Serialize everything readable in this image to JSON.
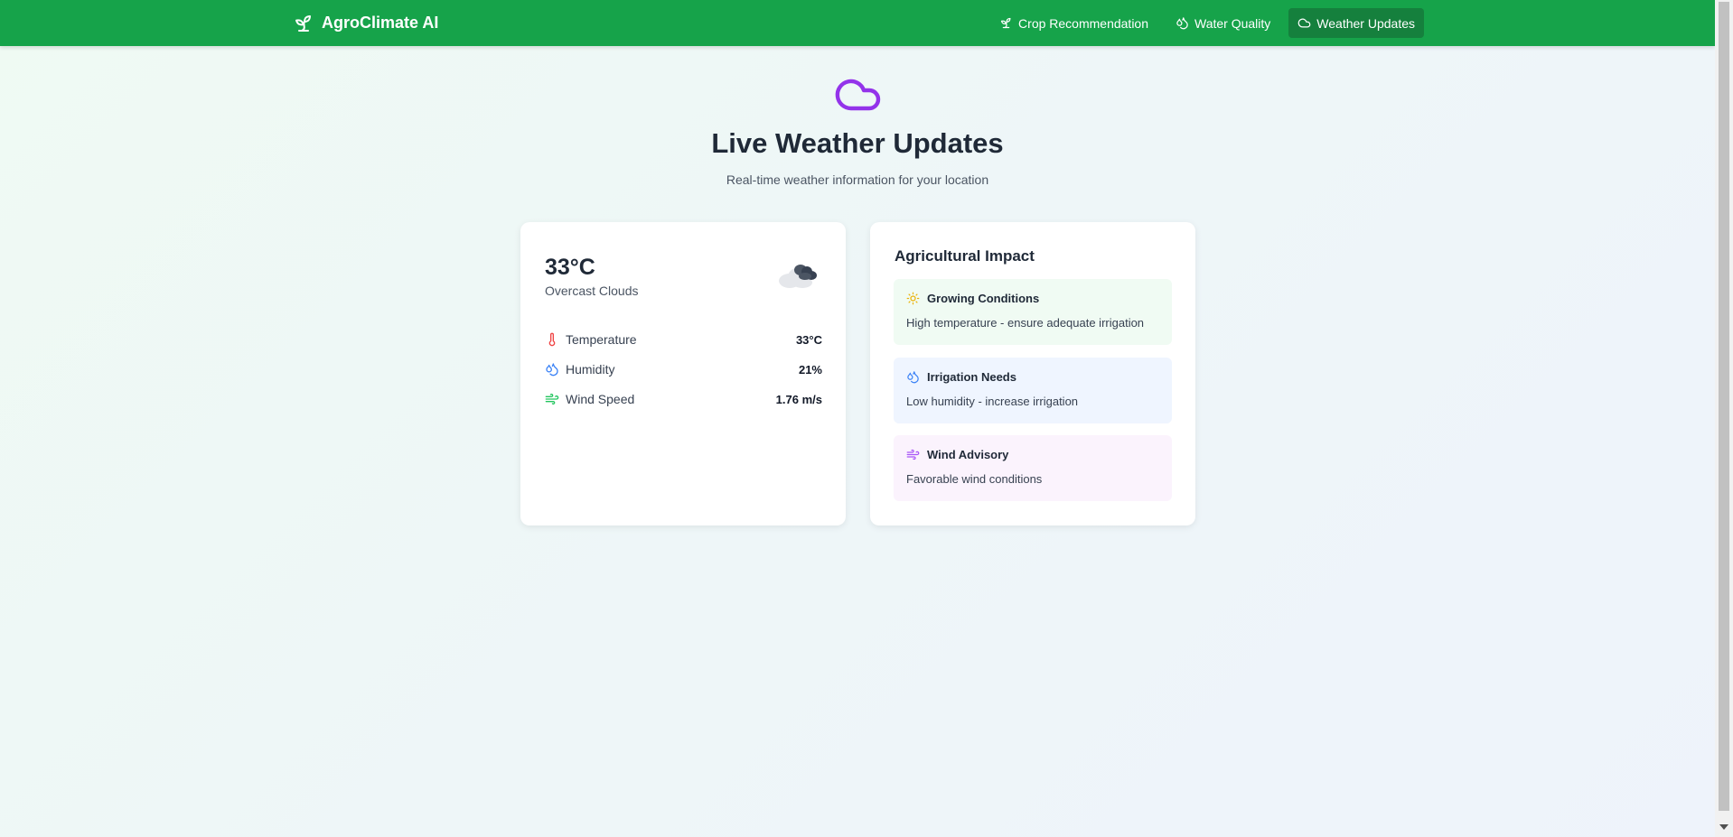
{
  "app": {
    "title": "AgroClimate AI"
  },
  "nav": {
    "items": [
      {
        "label": "Crop Recommendation",
        "icon": "sprout-icon"
      },
      {
        "label": "Water Quality",
        "icon": "droplets-icon"
      },
      {
        "label": "Weather Updates",
        "icon": "cloud-icon",
        "active": true
      }
    ]
  },
  "hero": {
    "title": "Live Weather Updates",
    "subtitle": "Real-time weather information for your location",
    "icon": "cloud-icon",
    "icon_color": "#9333ea"
  },
  "current": {
    "temperature": "33°C",
    "condition": "Overcast Clouds",
    "condition_icon": "overcast-cloud-icon",
    "metrics": [
      {
        "label": "Temperature",
        "value": "33°C",
        "icon": "thermometer-icon",
        "color": "#ef4444"
      },
      {
        "label": "Humidity",
        "value": "21%",
        "icon": "droplets-icon",
        "color": "#3b82f6"
      },
      {
        "label": "Wind Speed",
        "value": "1.76 m/s",
        "icon": "wind-icon",
        "color": "#22c55e"
      }
    ]
  },
  "impact": {
    "title": "Agricultural Impact",
    "items": [
      {
        "title": "Growing Conditions",
        "text": "High temperature - ensure adequate irrigation",
        "icon": "sun-icon",
        "color": "#eab308"
      },
      {
        "title": "Irrigation Needs",
        "text": "Low humidity - increase irrigation",
        "icon": "droplets-icon",
        "color": "#3b82f6"
      },
      {
        "title": "Wind Advisory",
        "text": "Favorable wind conditions",
        "icon": "wind-icon",
        "color": "#a855f7"
      }
    ]
  },
  "colors": {
    "nav_bg": "#16a34a",
    "nav_active": "#15803d"
  }
}
